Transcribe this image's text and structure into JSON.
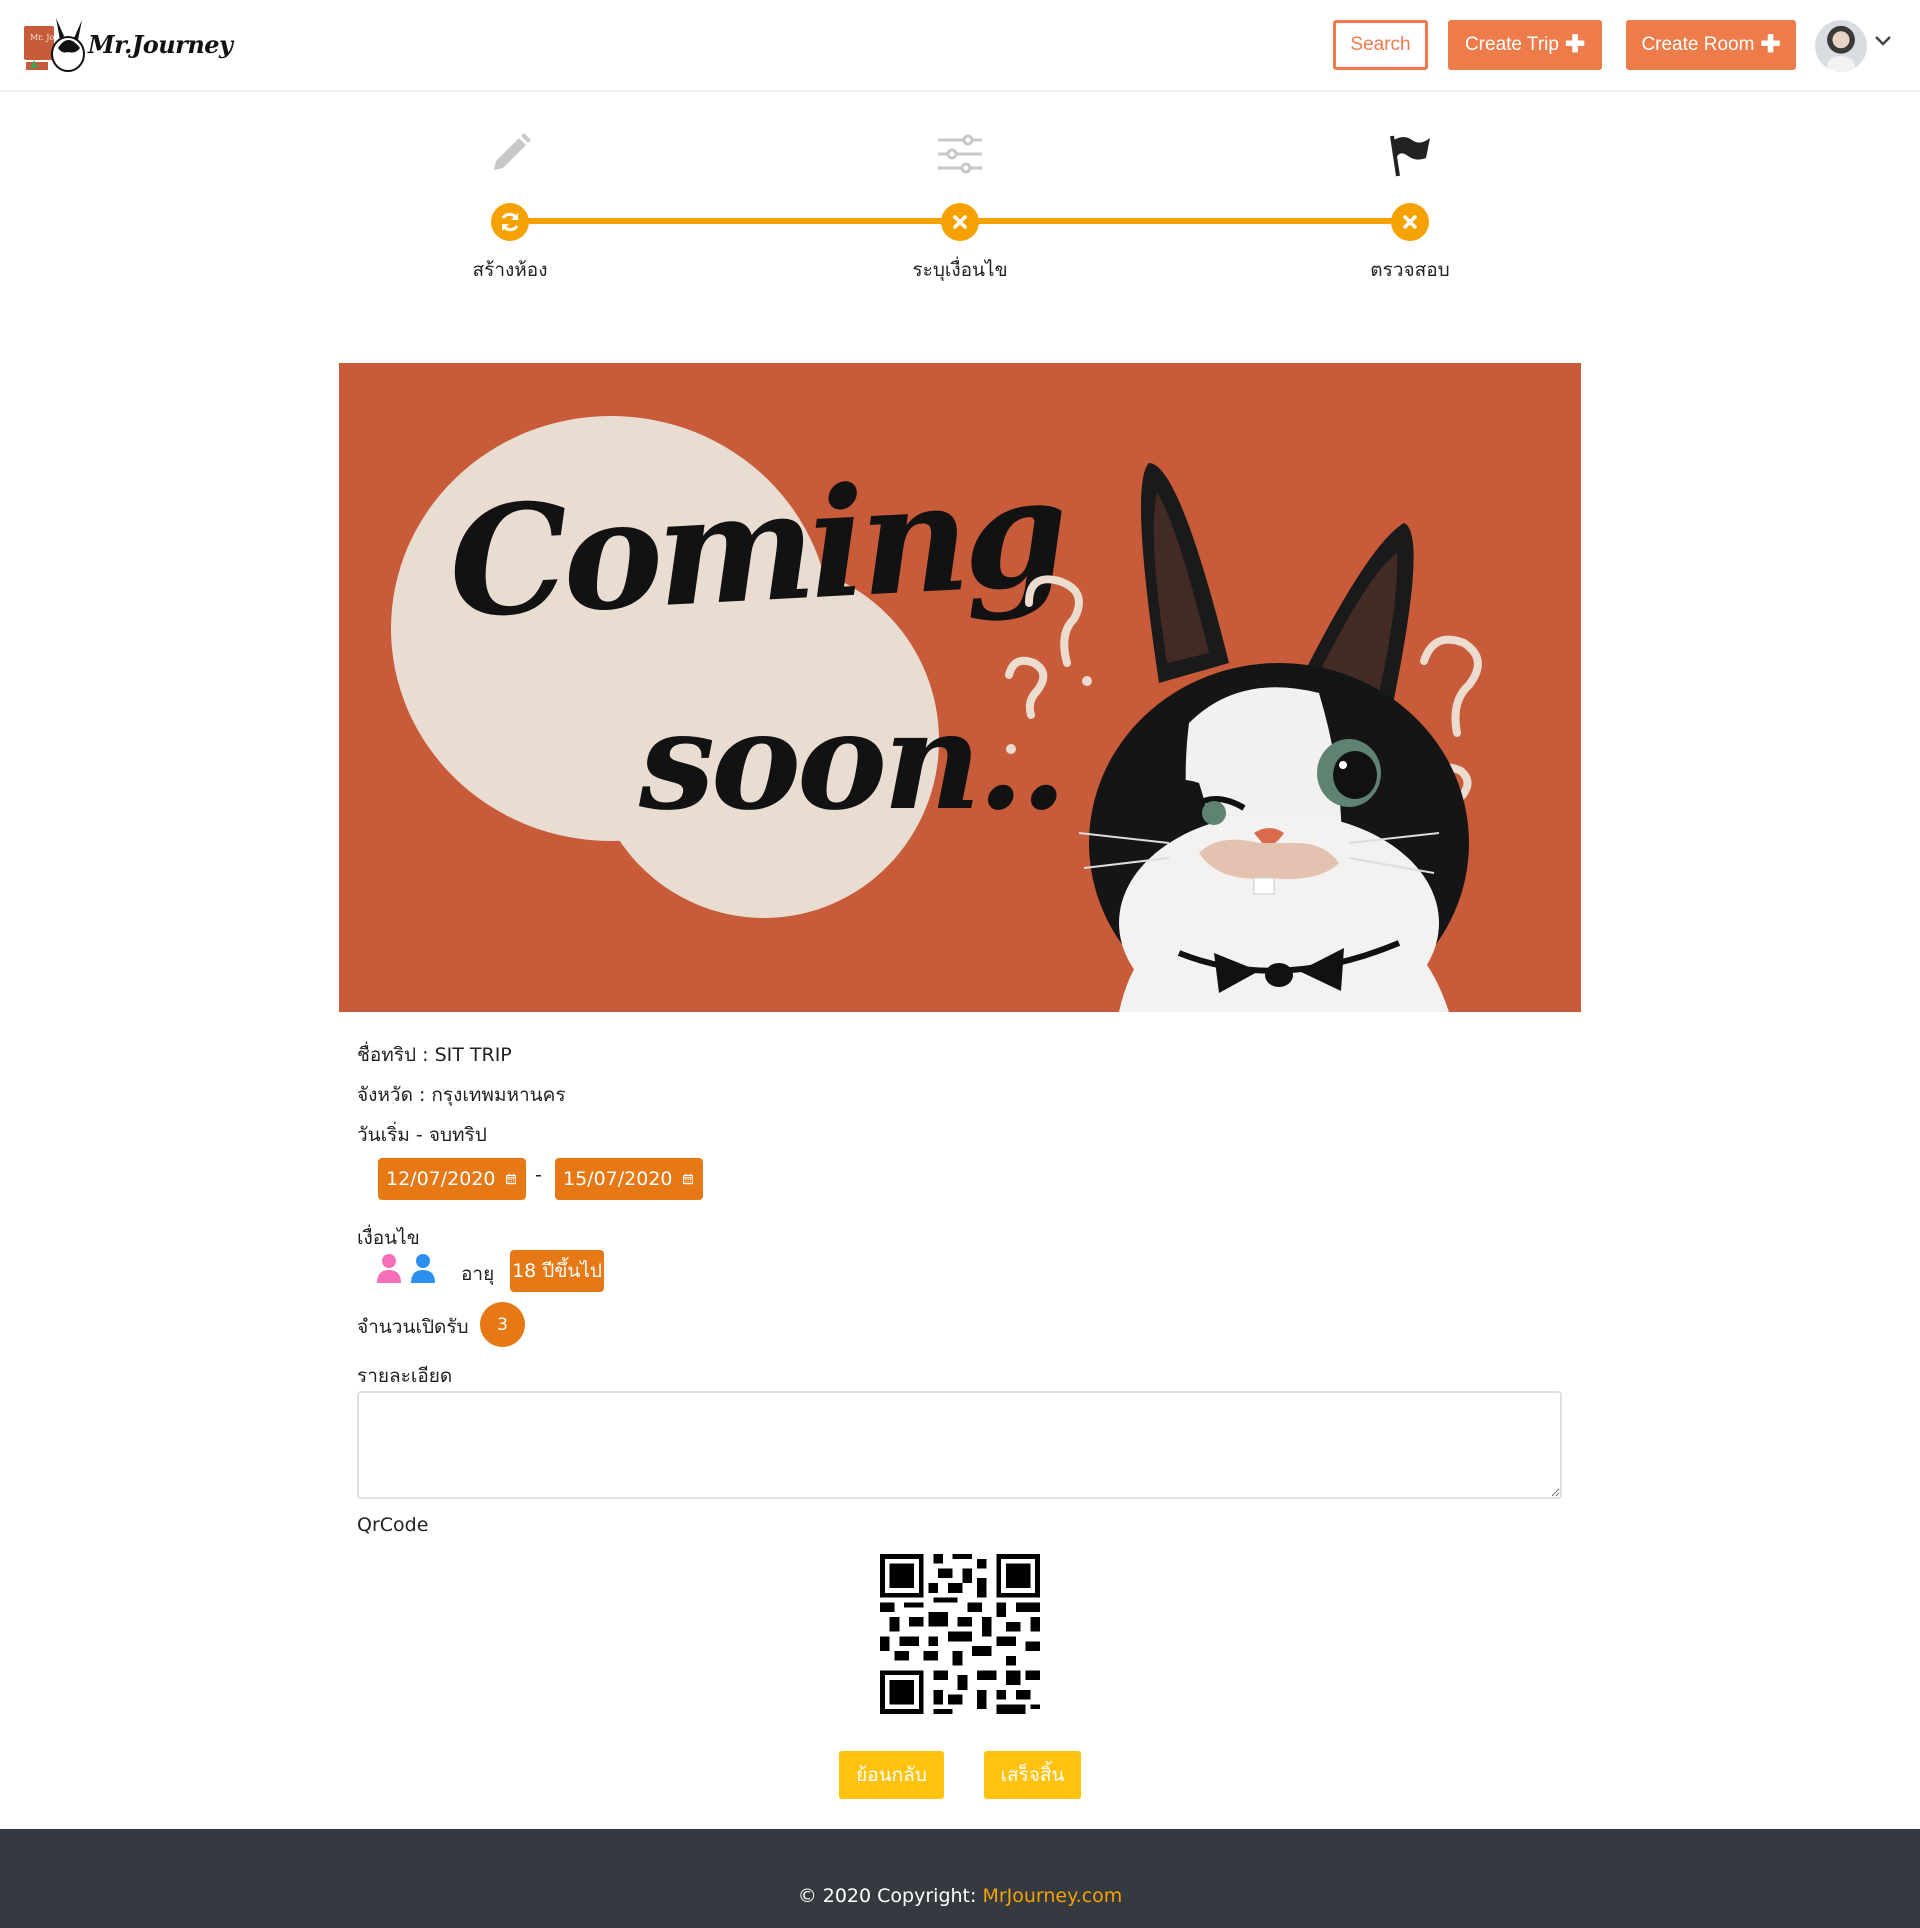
{
  "header": {
    "logo_text": "Mr.Journey",
    "logo_tag": "Mr. Jo",
    "search_label": "Search",
    "create_trip_label": "Create Trip",
    "create_room_label": "Create Room",
    "plus_symbol": "✚"
  },
  "stepper": {
    "steps": [
      {
        "label": "สร้างห้อง",
        "icon": "pencil-icon",
        "status": "refresh-icon"
      },
      {
        "label": "ระบุเงื่อนไข",
        "icon": "sliders-icon",
        "status": "close-icon"
      },
      {
        "label": "ตรวจสอบ",
        "icon": "flag-icon",
        "status": "close-icon"
      }
    ],
    "accent_color": "#f5a200"
  },
  "banner": {
    "line1": "Coming",
    "line2": "soon..",
    "background": "#c85b3a"
  },
  "trip": {
    "name_label": "ชื่อทริป : SIT TRIP",
    "province_label": "จังหวัด : กรุงเทพมหานคร",
    "dates_label": "วันเริ่ม - จบทริป",
    "start_date": "12/07/2020",
    "date_separator": "-",
    "end_date": "15/07/2020",
    "conditions_label": "เงื่อนไข",
    "age_label": "อายุ",
    "age_value": "18 ปีขึ้นไป",
    "capacity_label": "จำนวนเปิดรับ",
    "capacity_value": "3",
    "description_label": "รายละเอียด",
    "description_value": "",
    "qrcode_label": "QrCode"
  },
  "actions": {
    "back_label": "ย้อนกลับ",
    "finish_label": "เสร็จสิ้น"
  },
  "footer": {
    "copyright": "© 2020 Copyright: ",
    "site": "MrJourney.com"
  },
  "colors": {
    "primary": "#ee7c4b",
    "badge": "#e67816",
    "action": "#ffc20f",
    "female": "#f56fb8",
    "male": "#2b8ff0",
    "footer_bg": "#343a40"
  }
}
